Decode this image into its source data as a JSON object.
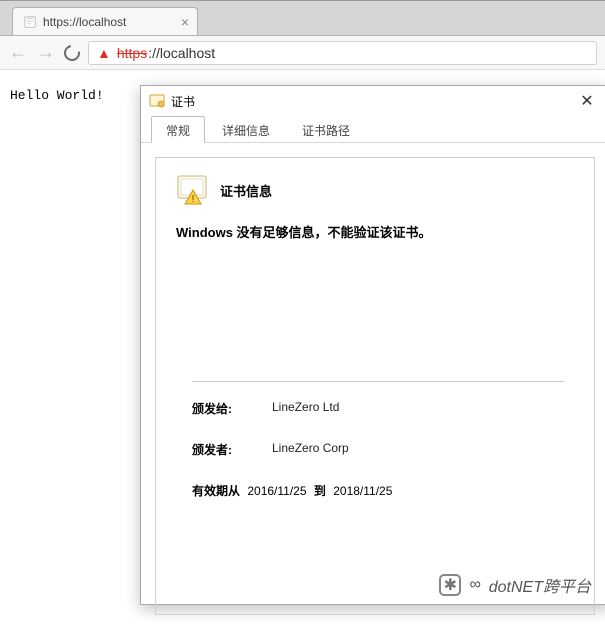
{
  "browser": {
    "tab_title": "https://localhost",
    "url_insecure_scheme": "https",
    "url_rest": "://localhost",
    "page_text": "Hello World!"
  },
  "dialog": {
    "title": "证书",
    "tabs": [
      "常规",
      "详细信息",
      "证书路径"
    ],
    "active_tab_index": 0,
    "info_heading": "证书信息",
    "info_warning": "Windows 没有足够信息，不能验证该证书。",
    "issued_to_label": "颁发给:",
    "issued_to_value": "LineZero Ltd",
    "issued_by_label": "颁发者:",
    "issued_by_value": "LineZero Corp",
    "valid_label_from": "有效期从",
    "valid_from": "2016/11/25",
    "valid_label_to": "到",
    "valid_to": "2018/11/25"
  },
  "watermark": {
    "prefix": "∞",
    "text": "dotNET跨平台"
  }
}
